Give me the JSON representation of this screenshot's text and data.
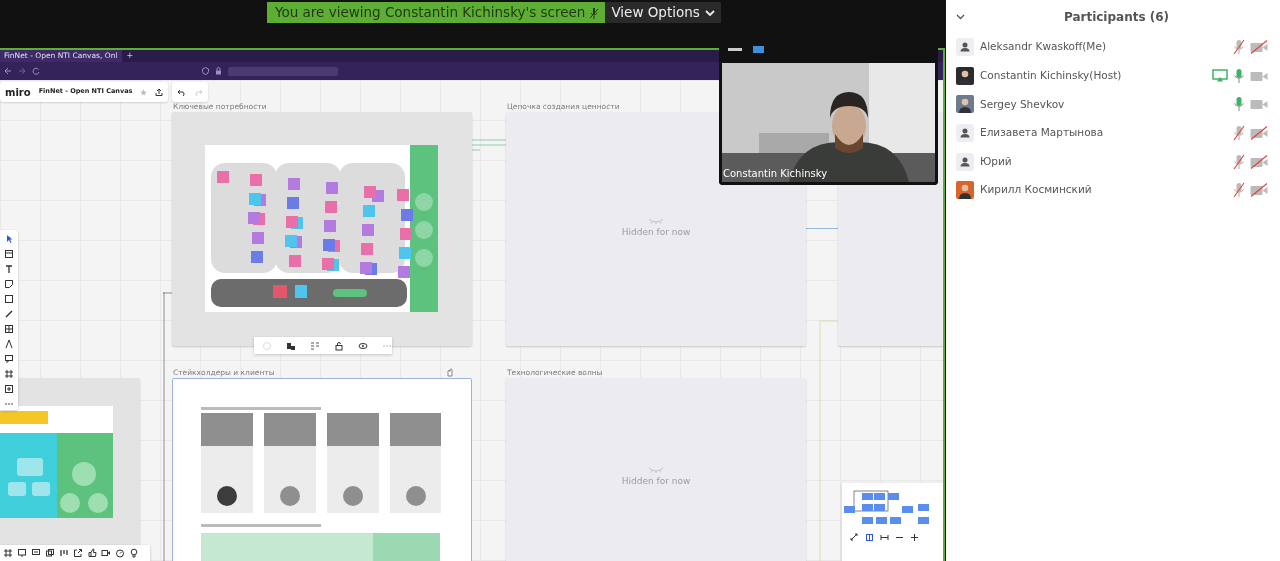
{
  "banner": {
    "text": "You are viewing Constantin Kichinsky's screen",
    "view_options": "View Options"
  },
  "shared_screen": {
    "browser": {
      "tab_title": "FinNet - Open NTI Canvas, Onl",
      "new_tab": "+"
    },
    "miro": {
      "logo": "miro",
      "board_name": "FinNet - Open NTI Canvas"
    },
    "frames": [
      {
        "kind": "board",
        "label": "Ключевые потребности"
      },
      {
        "kind": "hidden",
        "label": "Цепочка создания ценности",
        "hidden_text": "Hidden for now"
      },
      {
        "kind": "cards",
        "label": "Стейкхолдеры и клиенты"
      },
      {
        "kind": "hidden",
        "label": "Технологические волны",
        "hidden_text": "Hidden for now"
      }
    ],
    "video": {
      "name": "Constantin Kichinsky"
    }
  },
  "participants": {
    "title": "Participants (6)",
    "items": [
      {
        "name": "Aleksandr Kwaskoff(Me)",
        "has_photo": false,
        "sharing": false,
        "muted": true,
        "video_on": false
      },
      {
        "name": "Constantin Kichinsky(Host)",
        "has_photo": true,
        "color": "#2b2b2b",
        "sharing": true,
        "muted": false,
        "video_on": true
      },
      {
        "name": "Sergey Shevkov",
        "has_photo": true,
        "color": "#6d7c8c",
        "sharing": false,
        "muted": false,
        "video_on": true
      },
      {
        "name": "Елизавета Мартынова",
        "has_photo": false,
        "sharing": false,
        "muted": true,
        "video_on": false
      },
      {
        "name": "Юрий",
        "has_photo": false,
        "sharing": false,
        "muted": true,
        "video_on": false
      },
      {
        "name": "Кирилл Косминский",
        "has_photo": true,
        "color": "#d9652b",
        "sharing": false,
        "muted": true,
        "video_on": false
      }
    ]
  }
}
